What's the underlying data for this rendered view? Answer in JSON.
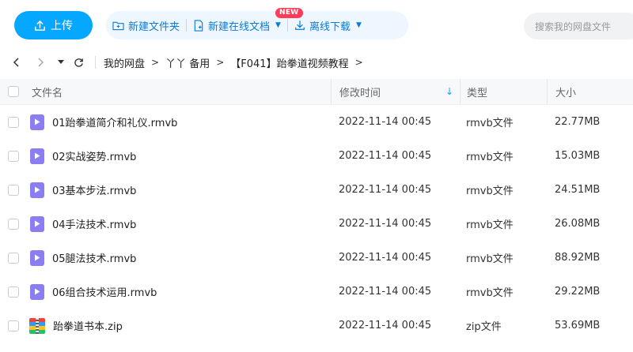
{
  "toolbar": {
    "upload_label": "上传",
    "new_folder_label": "新建文件夹",
    "new_online_doc_label": "新建在线文档",
    "new_badge": "NEW",
    "offline_download_label": "离线下载",
    "search_placeholder": "搜索我的网盘文件",
    "accent_color": "#06a7ff"
  },
  "breadcrumb": {
    "items": [
      "我的网盘",
      "丫丫 备用",
      "【F041】跆拳道视频教程"
    ]
  },
  "table": {
    "headers": {
      "name": "文件名",
      "modified": "修改时间",
      "type": "类型",
      "size": "大小"
    },
    "sort_icon": "sort-down-icon",
    "rows": [
      {
        "name": "01跆拳道简介和礼仪.rmvb",
        "modified": "2022-11-14 00:45",
        "type": "rmvb文件",
        "size": "22.77MB",
        "icon": "video-file-icon"
      },
      {
        "name": "02实战姿势.rmvb",
        "modified": "2022-11-14 00:45",
        "type": "rmvb文件",
        "size": "15.03MB",
        "icon": "video-file-icon"
      },
      {
        "name": "03基本步法.rmvb",
        "modified": "2022-11-14 00:45",
        "type": "rmvb文件",
        "size": "24.51MB",
        "icon": "video-file-icon"
      },
      {
        "name": "04手法技术.rmvb",
        "modified": "2022-11-14 00:45",
        "type": "rmvb文件",
        "size": "26.08MB",
        "icon": "video-file-icon"
      },
      {
        "name": "05腿法技术.rmvb",
        "modified": "2022-11-14 00:45",
        "type": "rmvb文件",
        "size": "88.92MB",
        "icon": "video-file-icon"
      },
      {
        "name": "06组合技术运用.rmvb",
        "modified": "2022-11-14 00:45",
        "type": "rmvb文件",
        "size": "29.22MB",
        "icon": "video-file-icon"
      },
      {
        "name": "跆拳道书本.zip",
        "modified": "2022-11-14 00:45",
        "type": "zip文件",
        "size": "53.69MB",
        "icon": "zip-file-icon"
      }
    ]
  }
}
